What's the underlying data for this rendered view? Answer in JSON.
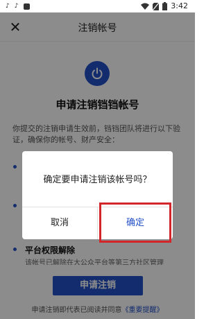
{
  "status_bar": {
    "left_icons": [
      "tiktok-icon",
      "tiktok-icon",
      "notification-icon"
    ],
    "time": "3:42"
  },
  "nav": {
    "title": "注销帐号",
    "close_symbol": "✕"
  },
  "page": {
    "headline": "申请注销铛铛帐号",
    "intro": "你提交的注销申请生效前，铛铛团队将进行以下验证，确保你的帐号、财产安全：",
    "section_title": "平台权限解除",
    "section_desc": "该帐号已解除在大公众平台等第三方社区管理",
    "apply_button": "申请注销",
    "footer_note_prefix": "申请注销即代表已阅读并同意",
    "footer_note_link": "《重要提醒》"
  },
  "dialog": {
    "message": "确定要申请注销该帐号吗？",
    "cancel_label": "取消",
    "confirm_label": "确定"
  },
  "colors": {
    "accent": "#2451c8",
    "highlight": "#d3262b"
  }
}
